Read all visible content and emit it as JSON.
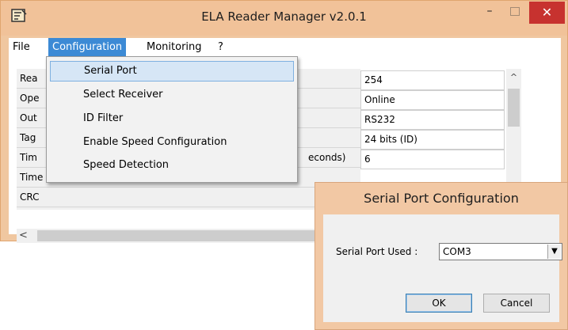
{
  "window": {
    "title": "ELA Reader Manager v2.0.1",
    "minimize": "–",
    "close": "✕"
  },
  "menubar": {
    "items": [
      "File",
      "Configuration",
      "Monitoring",
      "?"
    ]
  },
  "dropdown": {
    "items": [
      "Serial Port",
      "Select Receiver",
      "ID Filter",
      "Enable Speed Configuration",
      "Speed Detection"
    ]
  },
  "grid": {
    "labels": [
      "Rea",
      "Ope",
      "Out",
      "Tag",
      "Tim",
      "Time delay before sending the tag list (seconds)",
      "CRC"
    ],
    "partial_label": "econds)",
    "values": [
      "254",
      "Online",
      "RS232",
      "24 bits (ID)",
      "6"
    ]
  },
  "scroll": {
    "up_arrow": "^",
    "left_arrow": "<"
  },
  "dialog": {
    "title": "Serial Port Configuration",
    "label": "Serial Port Used :",
    "selected_port": "COM3",
    "ok_label": "OK",
    "cancel_label": "Cancel"
  },
  "colors": {
    "titlebar": "#f1c299",
    "menu_active": "#3c8ad5",
    "close_button": "#c7322f"
  }
}
